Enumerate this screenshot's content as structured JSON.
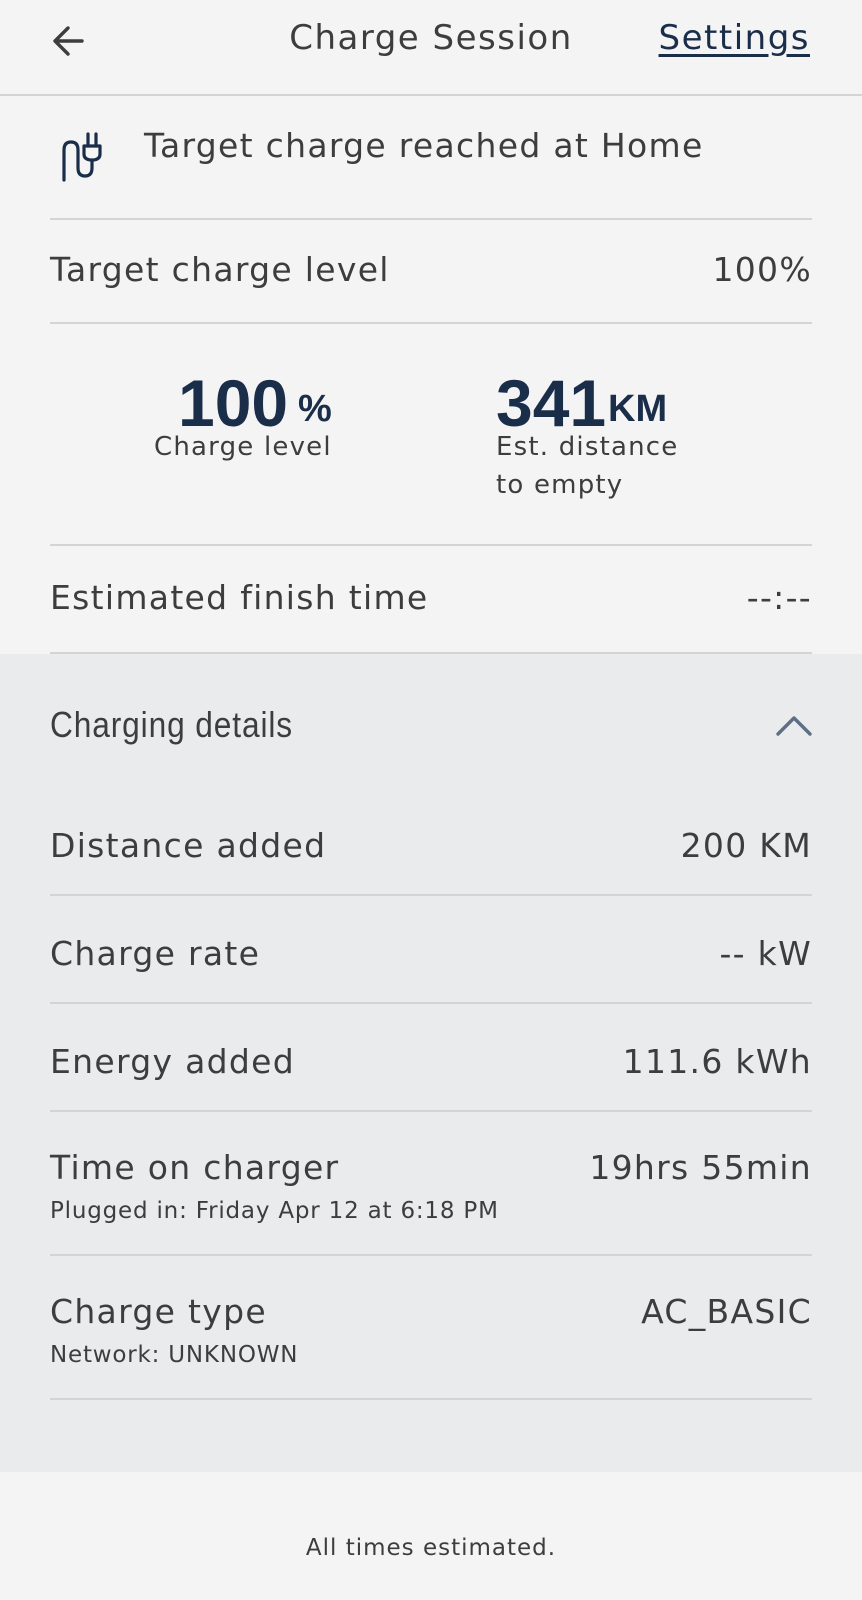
{
  "header": {
    "title": "Charge Session",
    "settings_label": "Settings",
    "back_icon": "arrow-left-icon"
  },
  "status": {
    "icon": "plug-icon",
    "text": "Target charge reached at Home"
  },
  "target_charge": {
    "label": "Target charge level",
    "value": "100%"
  },
  "stats": {
    "charge_level": {
      "value": "100",
      "unit": "%",
      "label": "Charge level"
    },
    "distance": {
      "value": "341",
      "unit": "KM",
      "label_line1": "Est. distance",
      "label_line2": "to empty"
    }
  },
  "finish_time": {
    "label": "Estimated finish time",
    "value": "--:--"
  },
  "details": {
    "title": "Charging details",
    "toggle_icon": "chevron-up-icon",
    "rows": [
      {
        "label": "Distance added",
        "value": "200 KM"
      },
      {
        "label": "Charge rate",
        "value": "-- kW"
      },
      {
        "label": "Energy added",
        "value": "111.6 kWh"
      },
      {
        "label": "Time on charger",
        "value": "19hrs 55min",
        "sub": "Plugged in: Friday Apr 12 at 6:18 PM"
      },
      {
        "label": "Charge type",
        "value": "AC_BASIC",
        "sub": "Network: UNKNOWN"
      }
    ]
  },
  "footer": {
    "note": "All times estimated."
  },
  "colors": {
    "background": "#f4f4f5",
    "details_background": "#eaebed",
    "brand_navy": "#1a2e4a",
    "divider": "#d3d4d6",
    "text": "#3d3d3d"
  }
}
